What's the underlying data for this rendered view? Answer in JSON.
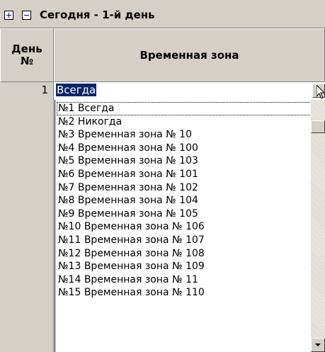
{
  "toolbar": {
    "title": "Сегодня - 1-й день",
    "add_icon": "plus-icon",
    "remove_icon": "minus-icon"
  },
  "grid": {
    "columns": [
      "День №",
      "Временная зона"
    ],
    "column_day_line1": "День",
    "column_day_line2": "№",
    "column_zone": "Временная зона",
    "row": {
      "day": "1",
      "zone_value": "Всегда"
    }
  },
  "dropdown": {
    "focused_index": 0,
    "items": [
      "№1 Всегда",
      "№2 Никогда",
      "№3 Временная зона № 10",
      "№4 Временная зона № 100",
      "№5 Временная зона № 103",
      "№6 Временная зона № 101",
      "№7 Временная зона № 102",
      "№8 Временная зона № 104",
      "№9 Временная зона № 105",
      "№10 Временная зона № 106",
      "№11 Временная зона № 107",
      "№12 Временная зона № 108",
      "№13 Временная зона № 109",
      "№14 Временная зона № 11",
      "№15 Временная зона № 110"
    ]
  },
  "colors": {
    "selection": "#0a246a",
    "face": "#d4d0c8"
  }
}
